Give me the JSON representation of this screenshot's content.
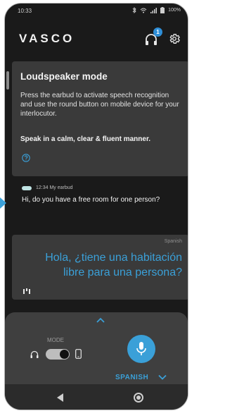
{
  "status_bar": {
    "time": "10:33",
    "battery": "100%",
    "icons": [
      "bluetooth-icon",
      "wifi-icon",
      "signal-icon",
      "battery-icon"
    ]
  },
  "header": {
    "logo": "VASCO",
    "notification_count": "1",
    "icons": [
      "headphones-icon",
      "gear-icon"
    ]
  },
  "info_card": {
    "title": "Loudspeaker mode",
    "description": "Press the earbud to activate speech recognition and use the round button on mobile device for your interlocutor.",
    "emphasis": "Speak in a calm, clear & fluent manner.",
    "icon": "help-icon"
  },
  "message": {
    "meta": "12:34 My earbud",
    "text": "Hi, do you have a free room for one person?"
  },
  "translation": {
    "language": "Spanish",
    "text": "Hola, ¿tiene una habitación libre para una persona?"
  },
  "controls": {
    "mode_label": "MODE",
    "mode_toggle_on": true,
    "language_selector": "SPANISH",
    "icons": [
      "chevron-up-icon",
      "headphones-icon",
      "phone-icon",
      "microphone-icon",
      "chevron-down-icon"
    ]
  },
  "nav": {
    "icons": [
      "back-icon",
      "home-icon"
    ]
  },
  "colors": {
    "accent": "#3aa0d8",
    "card": "#3a3a3a",
    "background": "#1a1a1a"
  }
}
